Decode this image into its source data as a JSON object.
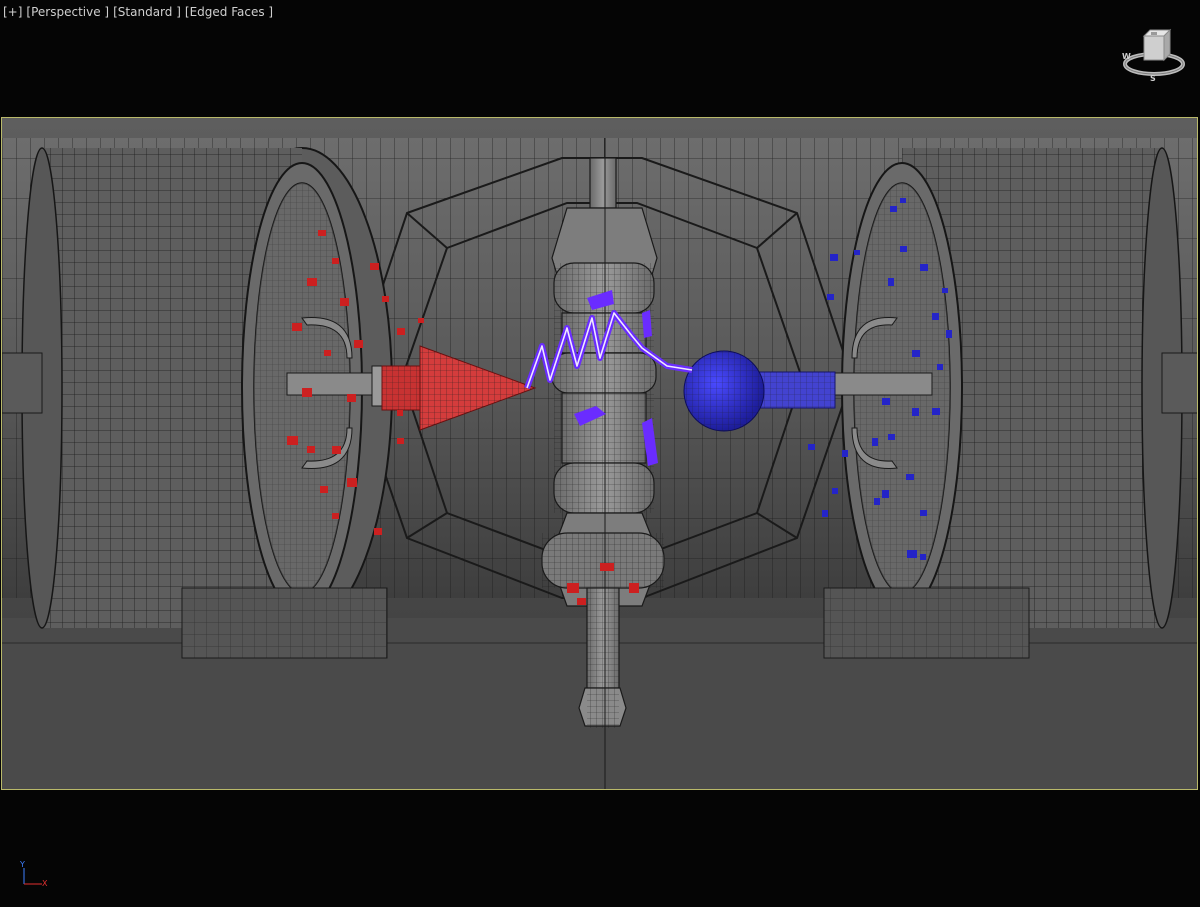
{
  "viewport": {
    "labels": [
      {
        "id": "plus-menu",
        "text": "[+]"
      },
      {
        "id": "view-perspective",
        "text": "[Perspective ]"
      },
      {
        "id": "shading-standard",
        "text": "[Standard ]"
      },
      {
        "id": "display-edged-faces",
        "text": "[Edged Faces ]"
      }
    ]
  },
  "viewcube": {
    "compass_w": "W",
    "compass_s": "S"
  },
  "axis_tripod": {
    "y_label": "Y",
    "x_label": "X",
    "y_color": "#3d7fff",
    "x_color": "#e33030"
  },
  "colors": {
    "background": "#050505",
    "safe_frame": "#b9b96a",
    "wireframe": "#1a1a1a",
    "red_object": "#e23a3a",
    "blue_object": "#3030d8",
    "purple_lightning": "#7a3cff"
  }
}
